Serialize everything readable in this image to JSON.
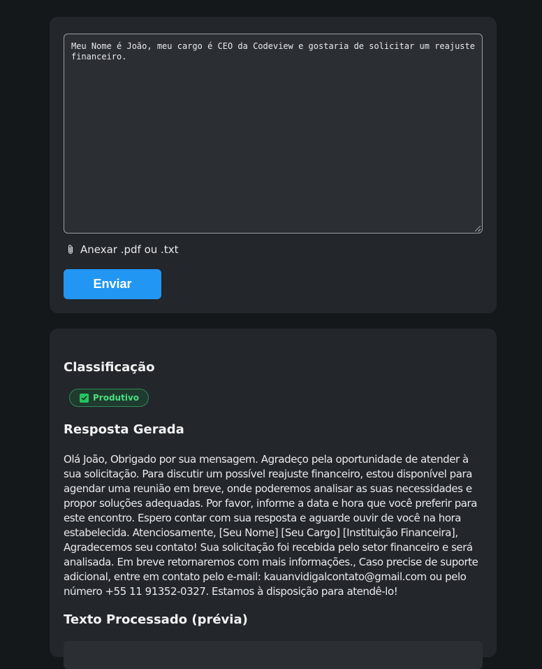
{
  "input_card": {
    "message_value": "Meu Nome é João, meu cargo é CEO da Codeview e gostaria de solicitar um reajuste financeiro.",
    "attach_label": "Anexar .pdf ou .txt",
    "attach_icon": "paperclip-icon",
    "send_label": "Enviar"
  },
  "result_card": {
    "classification_heading": "Classificação",
    "badge_label": "Produtivo",
    "badge_icon": "check-box-icon",
    "response_heading": "Resposta Gerada",
    "response_text": "Olá João, Obrigado por sua mensagem. Agradeço pela oportunidade de atender à sua solicitação. Para discutir um possível reajuste financeiro, estou disponível para agendar uma reunião em breve, onde poderemos analisar as suas necessidades e propor soluções adequadas. Por favor, informe a data e hora que você preferir para este encontro. Espero contar com sua resposta e aguarde ouvir de você na hora estabelecida. Atenciosamente, [Seu Nome] [Seu Cargo] [Instituição Financeira], Agradecemos seu contato! Sua solicitação foi recebida pelo setor financeiro e será analisada. Em breve retornaremos com mais informações., Caso precise de suporte adicional, entre em contato pelo e-mail: kauanvidigalcontato@gmail.com ou pelo número +55 11 91352-0327. Estamos à disposição para atendê-lo!",
    "processed_heading": "Texto Processado (prévia)"
  },
  "colors": {
    "page_background": "#15181b",
    "card_background": "#23262a",
    "accent": "#2196f3",
    "badge_green": "#4ade80"
  }
}
